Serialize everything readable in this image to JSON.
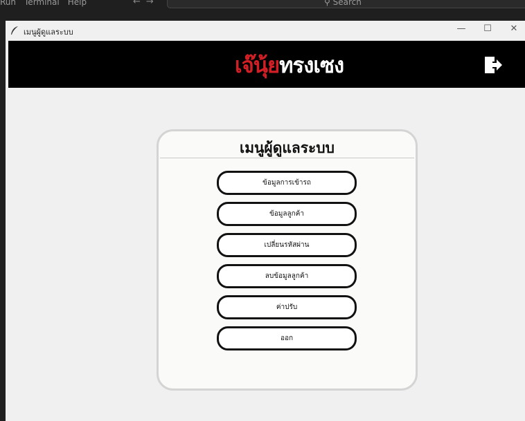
{
  "ide": {
    "menu": [
      "Run",
      "Terminal",
      "Help"
    ],
    "search_placeholder": "Search"
  },
  "window": {
    "title": "เมนูผู้ดูแลระบบ"
  },
  "header": {
    "logo_red": "เจ๊นุ้ย",
    "logo_white": "ทรงเซง",
    "exit_icon": "logout-icon"
  },
  "card": {
    "title": "เมนูผู้ดูแลระบบ",
    "buttons": [
      "ข้อมูลการเข้ารถ",
      "ข้อมูลลูกค้า",
      "เปลี่ยนรหัสผ่าน",
      "ลบข้อมูลลูกค้า",
      "ค่าปรับ",
      "ออก"
    ]
  },
  "colors": {
    "header_bg": "#000000",
    "logo_red": "#d21f26",
    "card_border": "#d4d4d4"
  }
}
